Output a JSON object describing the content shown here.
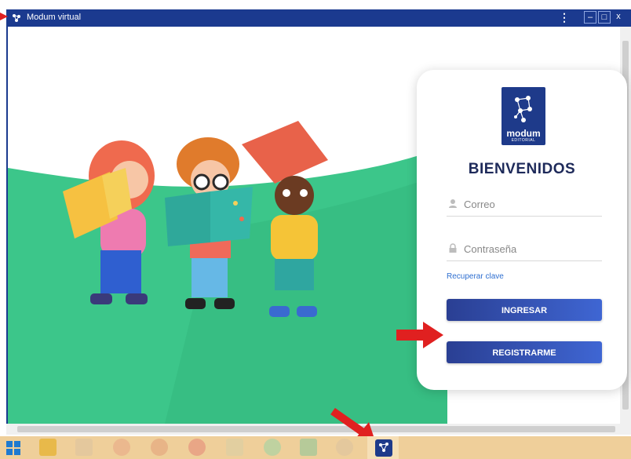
{
  "window": {
    "title": "Modum virtual"
  },
  "window_controls": {
    "minimize": "–",
    "maximize": "□",
    "close": "x",
    "menu": "⋮"
  },
  "brand": {
    "name": "modum",
    "sub": "EDITORIAL"
  },
  "login": {
    "welcome": "BIENVENIDOS",
    "email_placeholder": "Correo",
    "password_placeholder": "Contraseña",
    "recover_link": "Recuperar clave",
    "login_button": "INGRESAR",
    "register_button": "REGISTRARME"
  },
  "colors": {
    "titlebar": "#1b3a8f",
    "accent": "#2a3f93",
    "hill": "#3cc68a",
    "taskbar": "#efcf9a",
    "annotation_arrow": "#e02020"
  },
  "icons": [
    "app-logo-icon",
    "user-icon",
    "lock-icon",
    "windows-start-icon",
    "file-explorer-icon",
    "modum-app-icon"
  ]
}
